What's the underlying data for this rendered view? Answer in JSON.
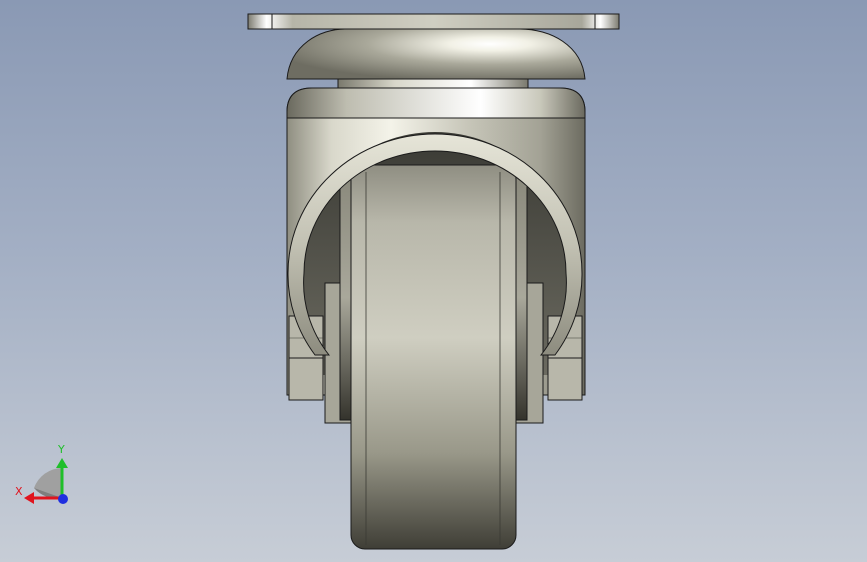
{
  "viewport": {
    "background_top": "#8a99b4",
    "background_bottom": "#c7cdd6"
  },
  "model": {
    "name_icon": "swivel-caster-wheel",
    "material_color": "#c4c3b4",
    "edge_color": "#1a1a1a"
  },
  "triad": {
    "x_label": "X",
    "y_label": "Y",
    "x_color": "#e0141e",
    "y_color": "#1fbf2a",
    "z_color": "#1f2fe0"
  }
}
